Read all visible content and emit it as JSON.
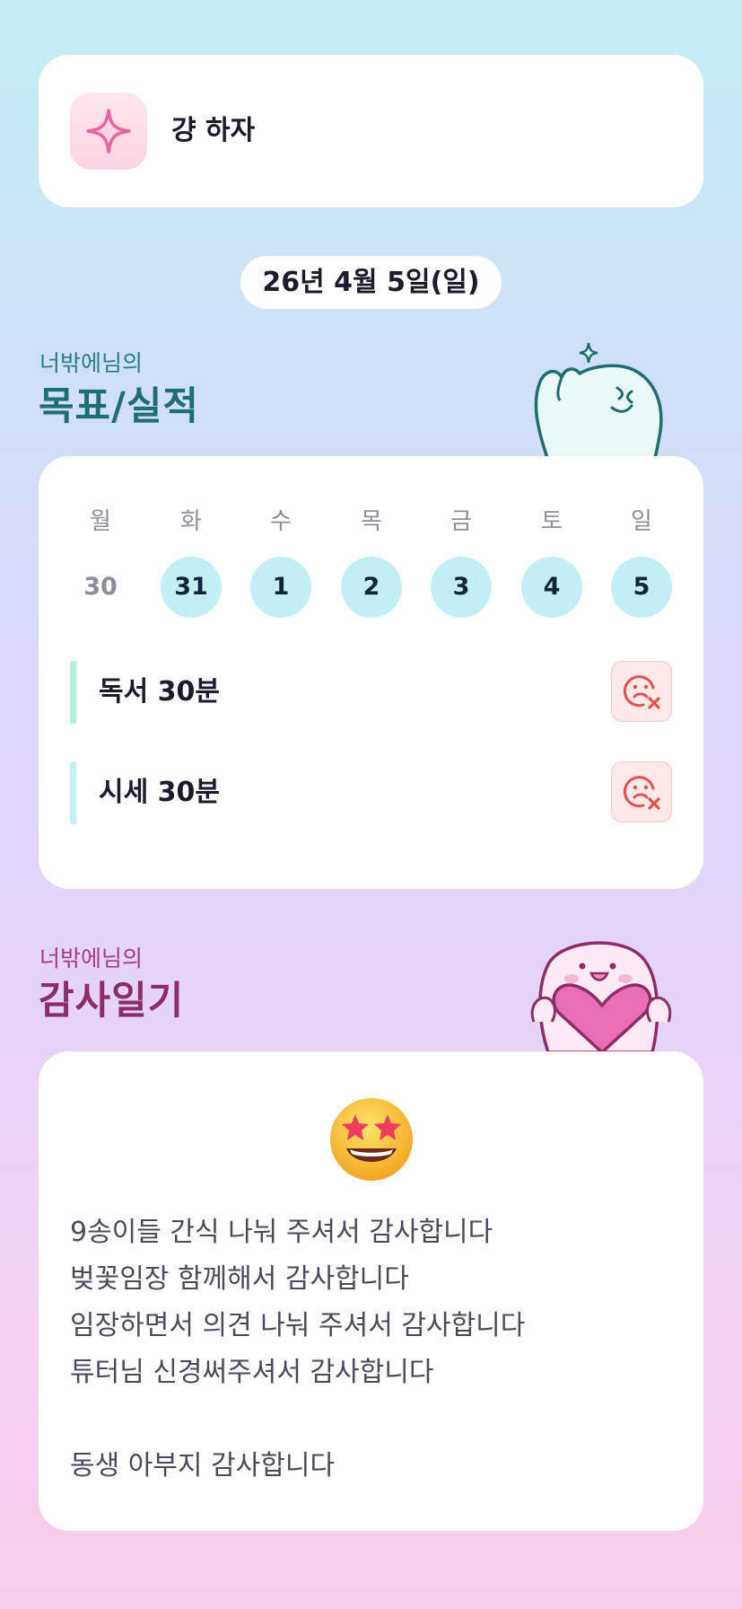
{
  "header": {
    "greeting": "걍 하자",
    "icon": "sparkle-icon"
  },
  "date": "26년 4월 5일(일)",
  "goals_section": {
    "subtitle": "너밖에님의",
    "title": "목표/실적"
  },
  "week": {
    "days": [
      "월",
      "화",
      "수",
      "목",
      "금",
      "토",
      "일"
    ],
    "dates": [
      "30",
      "31",
      "1",
      "2",
      "3",
      "4",
      "5"
    ],
    "highlighted": [
      false,
      true,
      true,
      true,
      true,
      true,
      true
    ]
  },
  "goals": [
    {
      "label": "독서 30분",
      "bar_color": "#b4efd9",
      "status_icon": "sad-face-x-icon"
    },
    {
      "label": "시세 30분",
      "bar_color": "#c5eff5",
      "status_icon": "sad-face-x-icon"
    }
  ],
  "diary_section": {
    "subtitle": "너밖에님의",
    "title": "감사일기"
  },
  "diary": {
    "emoji": "star-struck-emoji",
    "lines": [
      "9송이들 간식 나눠 주셔서 감사합니다",
      "벚꽃임장 함께해서 감사합니다",
      "임장하면서 의견 나눠 주셔서 감사합니다",
      "튜터님 신경써주셔서 감사합니다",
      "",
      "동생 아부지 감사합니다"
    ]
  },
  "colors": {
    "accent_cyan": "#c1eff4",
    "fail_red": "#e3514b",
    "goal_title": "#1e6f73",
    "diary_title": "#8e2c66"
  }
}
